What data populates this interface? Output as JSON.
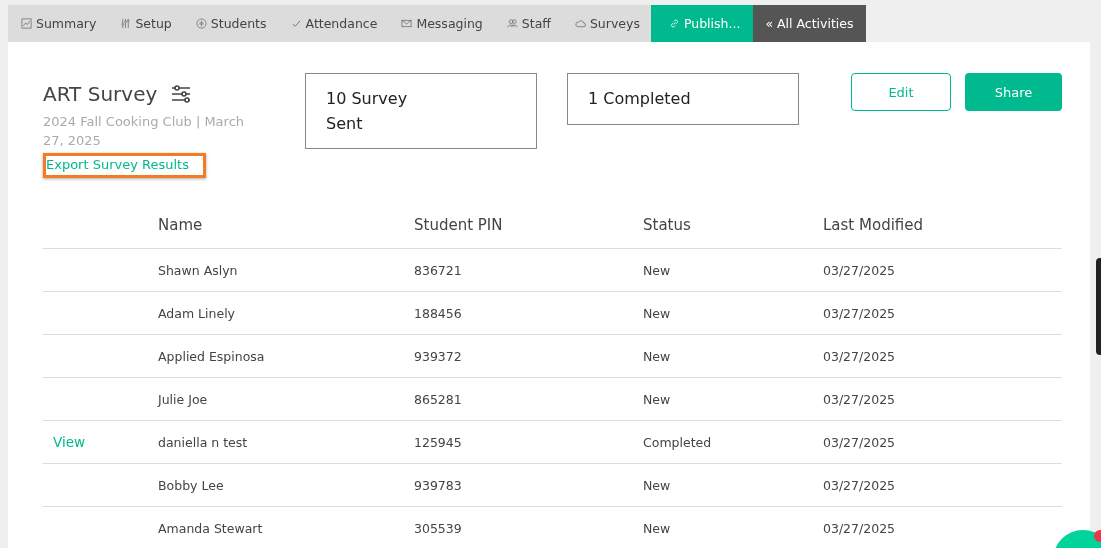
{
  "tabs": [
    {
      "label": "Summary",
      "selected": false
    },
    {
      "label": "Setup",
      "selected": false
    },
    {
      "label": "Students",
      "selected": false
    },
    {
      "label": "Attendance",
      "selected": false
    },
    {
      "label": "Messaging",
      "selected": false
    },
    {
      "label": "Staff",
      "selected": false
    },
    {
      "label": "Surveys",
      "selected": false
    },
    {
      "label": "Publish...",
      "selected": true
    }
  ],
  "back_button": "« All Activities",
  "survey": {
    "title": "ART Survey",
    "subtitle": "2024 Fall Cooking Club | March 27, 2025",
    "export_link": "Export Survey Results"
  },
  "stats": [
    "10 Survey Sent",
    "1 Completed"
  ],
  "buttons": {
    "edit": "Edit",
    "share": "Share"
  },
  "table": {
    "columns": [
      "Name",
      "Student PIN",
      "Status",
      "Last Modified"
    ],
    "rows": [
      {
        "name": "Shawn Aslyn",
        "pin": "836721",
        "status": "New",
        "modified": "03/27/2025"
      },
      {
        "name": "Adam Linely",
        "pin": "188456",
        "status": "New",
        "modified": "03/27/2025"
      },
      {
        "name": "Applied Espinosa",
        "pin": "939372",
        "status": "New",
        "modified": "03/27/2025"
      },
      {
        "name": "Julie Joe",
        "pin": "865281",
        "status": "New",
        "modified": "03/27/2025"
      },
      {
        "action": "View",
        "name": "daniella n test",
        "pin": "125945",
        "status": "Completed",
        "modified": "03/27/2025"
      },
      {
        "name": "Bobby Lee",
        "pin": "939783",
        "status": "New",
        "modified": "03/27/2025"
      },
      {
        "name": "Amanda Stewart",
        "pin": "305539",
        "status": "New",
        "modified": "03/27/2025"
      }
    ]
  }
}
